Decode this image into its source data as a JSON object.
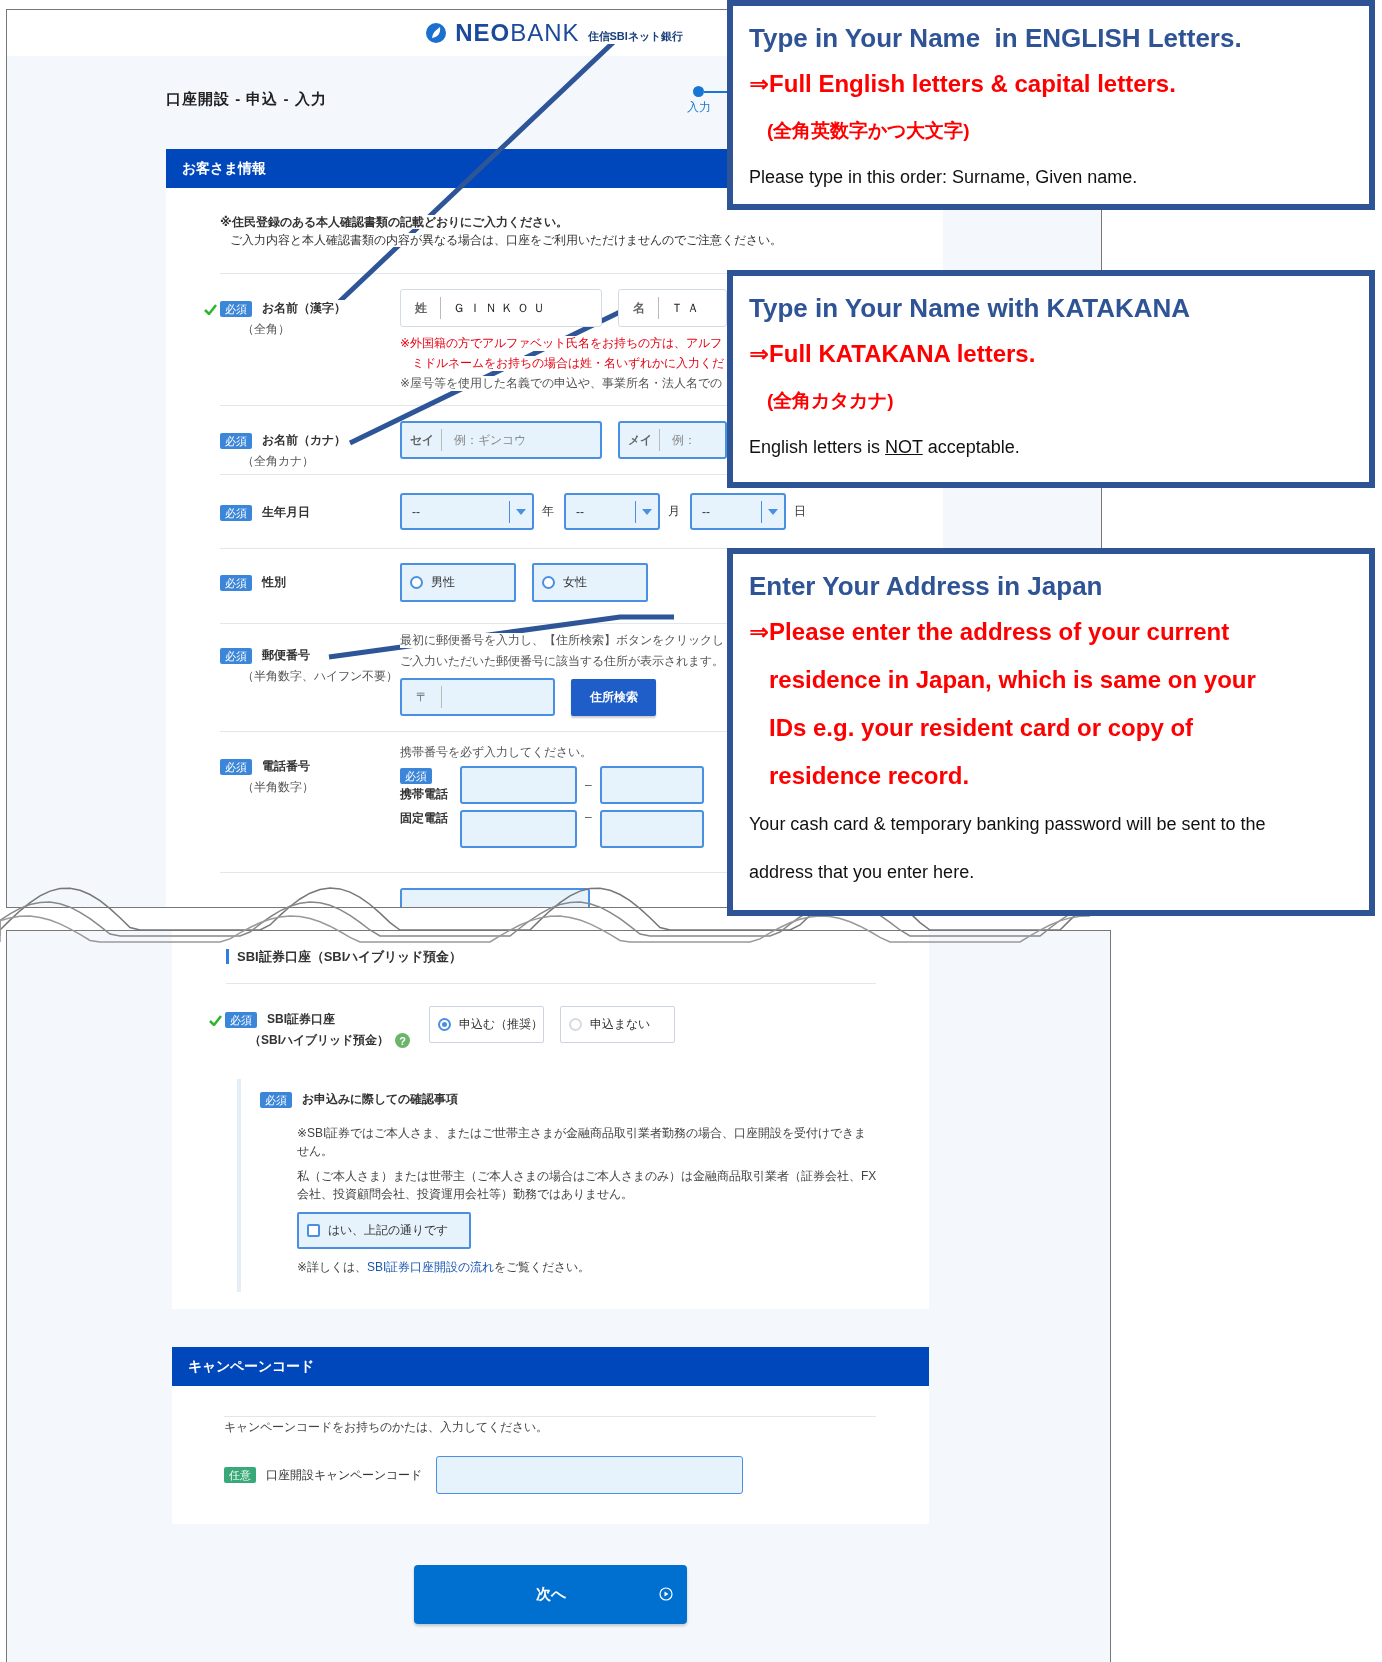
{
  "header": {
    "logo": "**NEO**BANK",
    "logo_sub": "住信SBIネット銀行"
  },
  "page_title": "口座開設 - 申込 - 入力",
  "steps": [
    {
      "label": "入力",
      "selected": true
    }
  ],
  "customer": {
    "title": "お客さま情報",
    "notices": [
      {
        "text": "※住民登録のある本人確認書類の記載どおりにご入力ください。",
        "bold": true
      },
      {
        "text": "ご入力内容と本人確認書類の内容が異なる場合は、口座をご利用いただけませんのでご注意ください。",
        "bold": false
      }
    ],
    "rows": [
      {
        "kind": "text_pair",
        "badge": "必須",
        "label": "お名前（漢字）",
        "sublabel": "（全角）",
        "valid": true,
        "fields": [
          {
            "prefix": "姓",
            "value": "ＧＩＮＫＯＵ"
          },
          {
            "prefix": "名",
            "value": "ＴＡ"
          }
        ],
        "notes": [
          {
            "text": "※外国籍の方でアルファベット氏名をお持ちの方は、アルフ",
            "warning": true,
            "continuation": false
          },
          {
            "text": "ミドルネームをお持ちの場合は姓・名いずれかに入力くだ",
            "warning": true,
            "continuation": true
          },
          {
            "text": "※屋号等を使用した名義での申込や、事業所名・法人名での",
            "warning": false,
            "continuation": false
          }
        ]
      },
      {
        "kind": "text_pair",
        "badge": "必須",
        "label": "お名前（カナ）",
        "sublabel": "（全角カナ）",
        "valid": false,
        "fields": [
          {
            "prefix": "セイ",
            "placeholder": "例：ギンコウ"
          },
          {
            "prefix": "メイ",
            "placeholder": "例："
          }
        ]
      },
      {
        "kind": "date",
        "badge": "必須",
        "label": "生年月日",
        "valid": false,
        "selects": [
          {
            "value": "--",
            "unit": "年"
          },
          {
            "value": "--",
            "unit": "月"
          },
          {
            "value": "--",
            "unit": "日"
          }
        ]
      },
      {
        "kind": "choice",
        "badge": "必須",
        "label": "性別",
        "valid": false,
        "options": [
          {
            "label": "男性",
            "selected": false
          },
          {
            "label": "女性",
            "selected": false
          }
        ]
      },
      {
        "kind": "postal",
        "badge": "必須",
        "label": "郵便番号",
        "sublabel": "（半角数字、ハイフン不要）",
        "valid": false,
        "texts": [
          "最初に郵便番号を入力し、【住所検索】ボタンをクリックし",
          "ご入力いただいた郵便番号に該当する住所が表示されます。"
        ],
        "prefix": "〒",
        "button": "住所検索"
      },
      {
        "kind": "phone",
        "badge": "必須",
        "label": "電話番号",
        "sublabel": "（半角数字）",
        "valid": false,
        "note": "携帯番号を必ず入力してください。",
        "lines": [
          {
            "badge": "必須",
            "label": "携帯電話",
            "separator": "–"
          },
          {
            "label": "固定電話",
            "separator": "–"
          }
        ]
      },
      {
        "kind": "cut_field"
      }
    ]
  },
  "securities": {
    "heading": "SBI証券口座（SBIハイブリッド預金）",
    "badge": "必須",
    "label": "SBI証券口座",
    "sublabel": "（SBIハイブリッド預金）",
    "help": "?",
    "valid": true,
    "options": [
      {
        "label": "申込む（推奨）",
        "selected": true
      },
      {
        "label": "申込まない",
        "selected": false
      }
    ],
    "confirm": {
      "badge": "必須",
      "title": "お申込みに際しての確認事項",
      "paragraphs": [
        "※SBI証券ではご本人さま、またはご世帯主さまが金融商品取引業者勤務の場合、口座開設を受付けできません。",
        "私（ご本人さま）または世帯主（ご本人さまの場合はご本人さまのみ）は金融商品取引業者（証券会社、FX会社、投資顧問会社、投資運用会社等）勤務ではありません。"
      ],
      "checkbox": {
        "label": "はい、上記の通りです",
        "checked": false
      },
      "note_before": "※詳しくは、",
      "link": "SBI証券口座開設の流れ",
      "note_after": "をご覧ください。"
    }
  },
  "campaign": {
    "title": "キャンペーンコード",
    "note": "キャンペーンコードをお持ちのかたは、入力してください。",
    "badge": "任意",
    "required": false,
    "label": "口座開設キャンペーンコード"
  },
  "next_button": "次へ",
  "callouts": [
    {
      "title": "Type in Your Name  in ENGLISH Letters.",
      "lead": "⇒Full English letters & capital letters.",
      "sub": "(全角英数字かつ大文字)",
      "body": [
        {
          "text": "Please type in this order: Surname, Given name.",
          "underline": false
        }
      ]
    },
    {
      "title": "Type in Your Name with KATAKANA",
      "lead": "⇒Full KATAKANA letters.",
      "sub": "(全角カタカナ)",
      "body": [
        {
          "text": "English letters is ",
          "underline": false
        },
        {
          "text": "NOT",
          "underline": true
        },
        {
          "text": " acceptable.",
          "underline": false
        }
      ]
    },
    {
      "title": "Enter Your Address in Japan",
      "lead": "⇒Please enter the address of your current residence in Japan, which is same on your IDs e.g. your resident card or copy of residence record.",
      "body": [
        {
          "text": "Your cash card & temporary banking password will be sent to the address that you enter here.",
          "underline": false
        }
      ]
    }
  ]
}
